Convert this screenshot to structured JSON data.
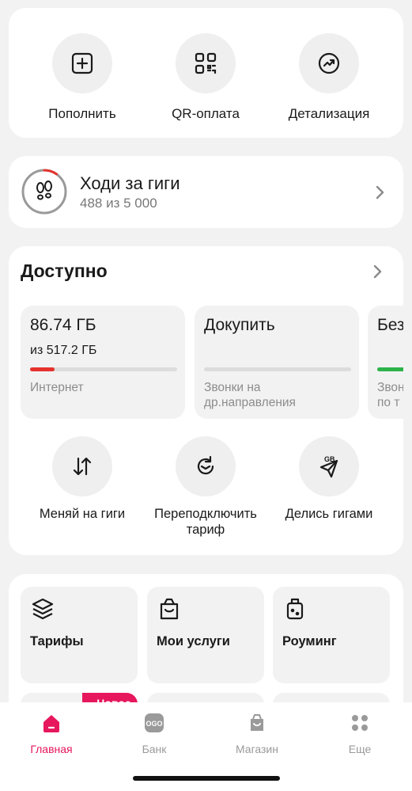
{
  "quick_actions": {
    "topup": "Пополнить",
    "qr": "QR-оплата",
    "details": "Детализация"
  },
  "steps": {
    "title": "Ходи за гиги",
    "progress_text": "488 из 5 000",
    "progress_value": 488,
    "progress_total": 5000
  },
  "available": {
    "title": "Доступно",
    "tiles": [
      {
        "big": "86.74 ГБ",
        "sub": "из 517.2 ГБ",
        "caption": "Интернет",
        "fill_percent": 16.8,
        "color": "#e5322d"
      },
      {
        "big": "Докупить",
        "sub": "",
        "caption": "Звонки на др.направления",
        "fill_percent": 0,
        "color": "#dcdcdc"
      },
      {
        "big": "Без",
        "sub": "",
        "caption": "Звон по т",
        "fill_percent": 100,
        "color": "#2db34a"
      }
    ],
    "actions": {
      "swap": "Меняй на гиги",
      "reconnect": "Переподключить тариф",
      "share": "Делись гигами"
    }
  },
  "services": {
    "tariffs": "Тарифы",
    "my_services": "Мои услуги",
    "roaming": "Роуминг",
    "badge": "Новое"
  },
  "tabbar": {
    "home": "Главная",
    "bank": "Банк",
    "shop": "Магазин",
    "more": "Еще",
    "active_color": "#e6175c"
  }
}
